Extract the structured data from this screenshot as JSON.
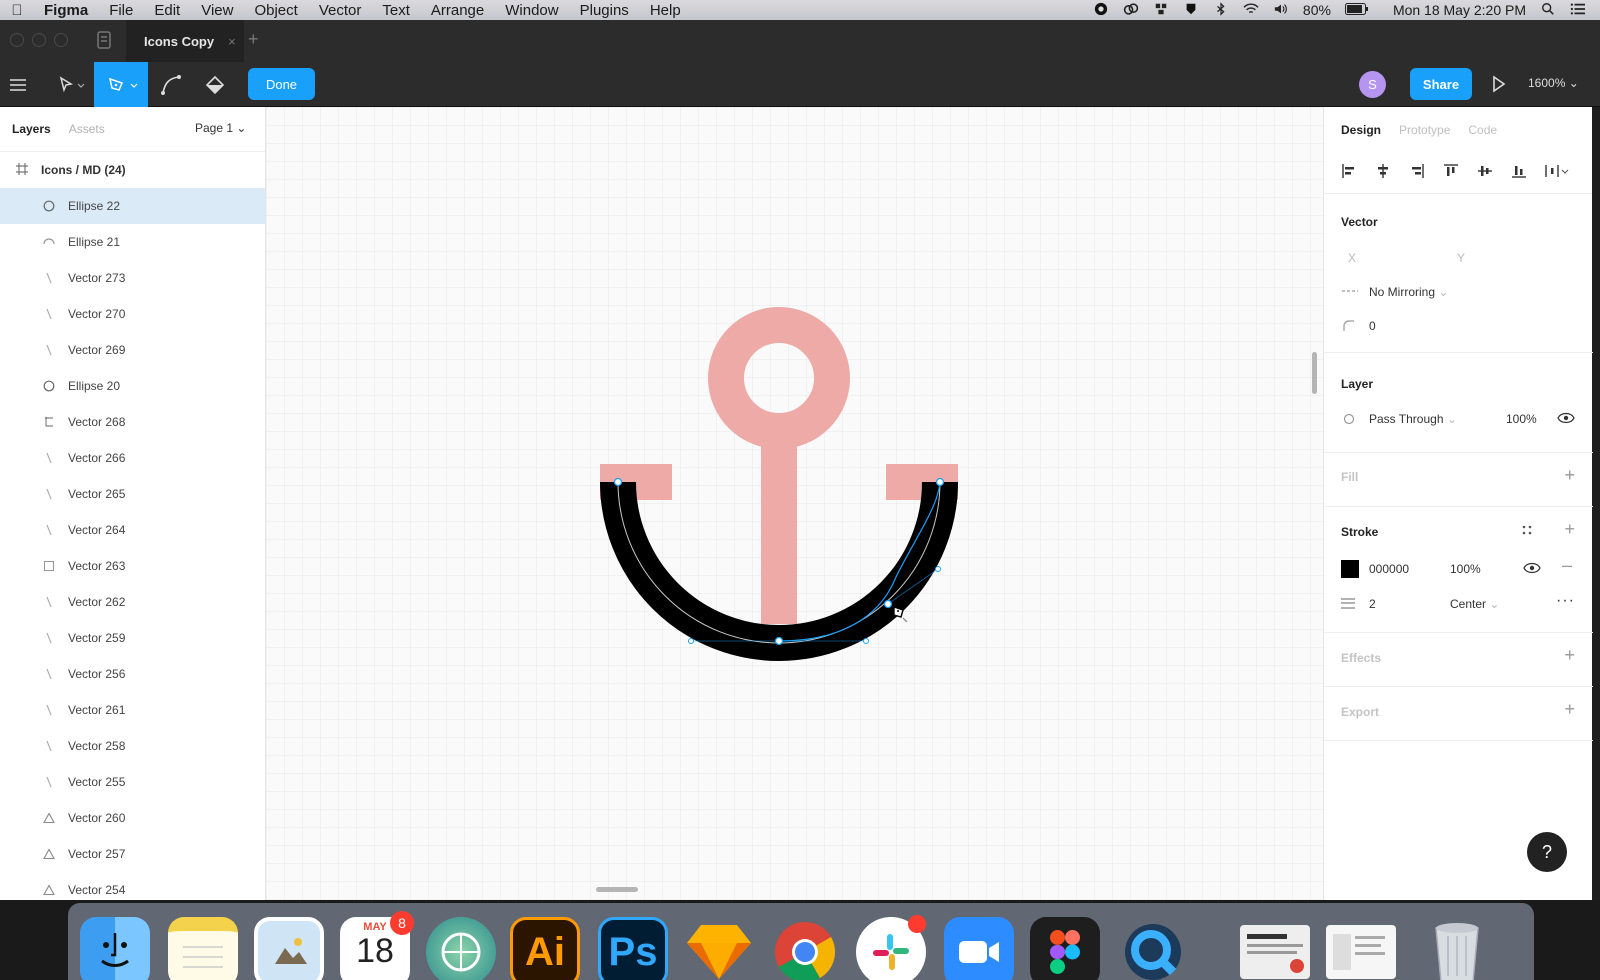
{
  "menubar": {
    "items": [
      "Figma",
      "File",
      "Edit",
      "View",
      "Object",
      "Vector",
      "Text",
      "Arrange",
      "Window",
      "Plugins",
      "Help"
    ],
    "battery": "80%",
    "clock": "Mon 18 May  2:20 PM"
  },
  "titlebar": {
    "file_tab": "Icons Copy"
  },
  "toolbar": {
    "done_label": "Done",
    "avatar_letter": "S",
    "share_label": "Share",
    "zoom": "1600%"
  },
  "layers_panel": {
    "tab_layers": "Layers",
    "tab_assets": "Assets",
    "page": "Page 1",
    "frame": "Icons / MD (24)",
    "layers": [
      {
        "name": "Ellipse 22",
        "icon": "ellipse-icon",
        "selected": true
      },
      {
        "name": "Ellipse 21",
        "icon": "arc-icon"
      },
      {
        "name": "Vector 273",
        "icon": "line-icon"
      },
      {
        "name": "Vector 270",
        "icon": "line-icon"
      },
      {
        "name": "Vector 269",
        "icon": "line-icon"
      },
      {
        "name": "Ellipse 20",
        "icon": "ellipse-icon"
      },
      {
        "name": "Vector 268",
        "icon": "vector-path-icon"
      },
      {
        "name": "Vector 266",
        "icon": "line-icon"
      },
      {
        "name": "Vector 265",
        "icon": "line-icon"
      },
      {
        "name": "Vector 264",
        "icon": "line-icon"
      },
      {
        "name": "Vector 263",
        "icon": "square-icon"
      },
      {
        "name": "Vector 262",
        "icon": "line-icon"
      },
      {
        "name": "Vector 259",
        "icon": "line-icon"
      },
      {
        "name": "Vector 256",
        "icon": "line-icon"
      },
      {
        "name": "Vector 261",
        "icon": "line-icon"
      },
      {
        "name": "Vector 258",
        "icon": "line-icon"
      },
      {
        "name": "Vector 255",
        "icon": "line-icon"
      },
      {
        "name": "Vector 260",
        "icon": "triangle-icon"
      },
      {
        "name": "Vector 257",
        "icon": "triangle-icon"
      },
      {
        "name": "Vector 254",
        "icon": "triangle-icon"
      }
    ]
  },
  "design_panel": {
    "tab_design": "Design",
    "tab_prototype": "Prototype",
    "tab_code": "Code",
    "vector": {
      "title": "Vector",
      "x_label": "X",
      "y_label": "Y",
      "mirroring": "No Mirroring",
      "corner_radius": "0"
    },
    "layer": {
      "title": "Layer",
      "blend": "Pass Through",
      "opacity": "100%"
    },
    "fill": {
      "title": "Fill"
    },
    "stroke": {
      "title": "Stroke",
      "color_hex": "000000",
      "opacity": "100%",
      "weight": "2",
      "position": "Center"
    },
    "effects": {
      "title": "Effects"
    },
    "export": {
      "title": "Export"
    }
  },
  "help_label": "?",
  "colors": {
    "accent": "#18a0fb",
    "anchor_pink": "#eeaaa7",
    "stroke": "#000000",
    "selection_bg": "#daebf7"
  },
  "dock": {
    "apps": [
      "finder",
      "notes",
      "preview",
      "calendar",
      "network-radar",
      "illustrator",
      "photoshop",
      "sketch",
      "chrome",
      "slack",
      "zoom",
      "figma",
      "quicktime",
      "window-thumbnail-1",
      "window-thumbnail-2",
      "trash"
    ],
    "calendar_month": "MAY",
    "calendar_day": "18",
    "calendar_badge": "8",
    "illustrator_label": "Ai",
    "photoshop_label": "Ps"
  }
}
